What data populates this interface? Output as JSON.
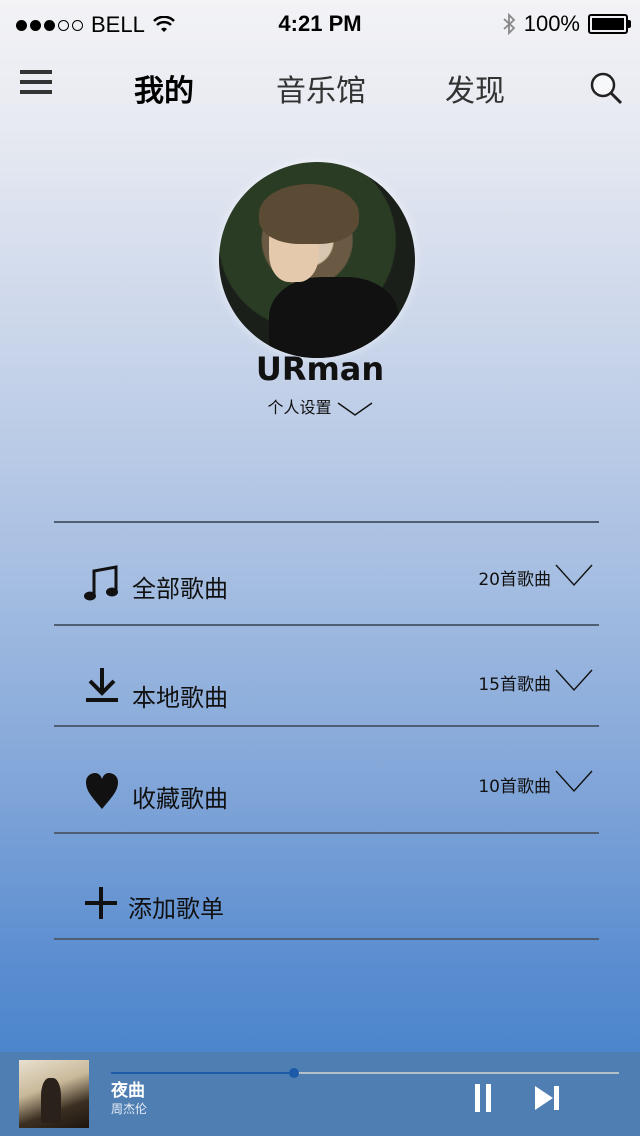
{
  "status_bar": {
    "carrier": "BELL",
    "time": "4:21 PM",
    "battery": "100%",
    "signal_icon": "signal-dots-icon",
    "wifi_icon": "wifi-icon",
    "bluetooth_icon": "bluetooth-icon"
  },
  "nav": {
    "tabs": [
      {
        "label": "我的",
        "active": true
      },
      {
        "label": "音乐馆",
        "active": false
      },
      {
        "label": "发现",
        "active": false
      }
    ],
    "menu_icon": "hamburger-menu-icon",
    "search_icon": "search-icon"
  },
  "profile": {
    "username": "URman",
    "settings_label": "个人设置"
  },
  "library": {
    "items": [
      {
        "icon": "music-note-icon",
        "label": "全部歌曲",
        "count": "20首歌曲"
      },
      {
        "icon": "download-icon",
        "label": "本地歌曲",
        "count": "15首歌曲"
      },
      {
        "icon": "heart-icon",
        "label": "收藏歌曲",
        "count": "10首歌曲"
      }
    ],
    "add_playlist": {
      "icon": "plus-icon",
      "label": "添加歌单"
    }
  },
  "player": {
    "title": "夜曲",
    "artist": "周杰伦",
    "progress": 0.36,
    "pause_icon": "pause-icon",
    "next_icon": "skip-next-icon"
  },
  "colors": {
    "progress_played": "#1d5aa8",
    "player_bar": "#4f7fb2",
    "divider": "#4f5e72"
  }
}
